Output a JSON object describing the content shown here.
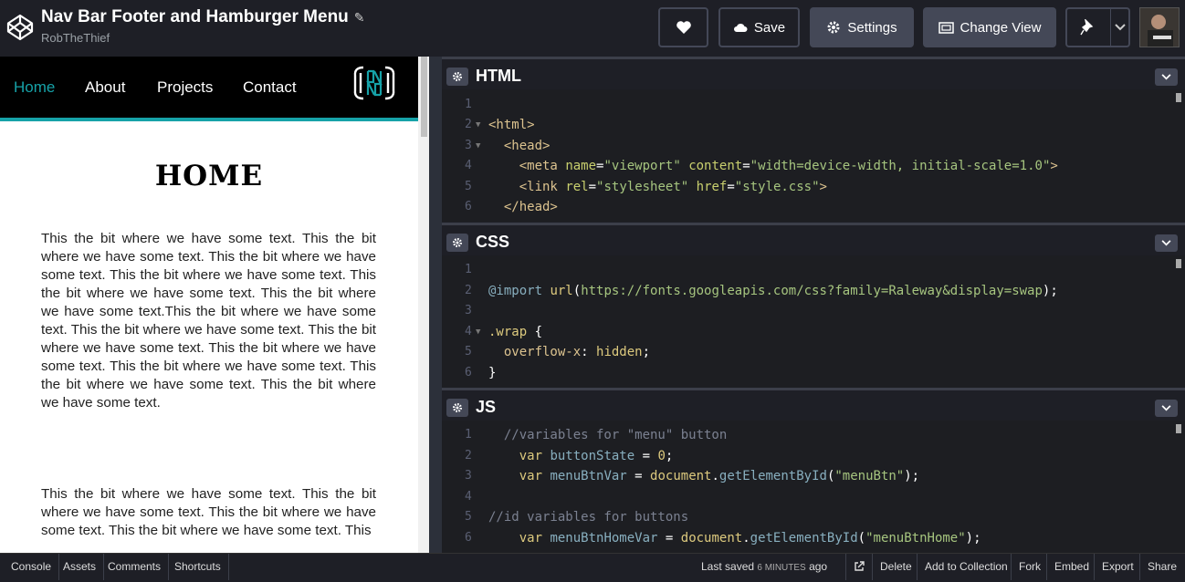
{
  "header": {
    "title": "Nav Bar Footer and Hamburger Menu",
    "author": "RobTheThief",
    "save_label": "Save",
    "settings_label": "Settings",
    "change_view_label": "Change View"
  },
  "preview": {
    "nav": [
      "Home",
      "About",
      "Projects",
      "Contact"
    ],
    "heading": "HOME",
    "paragraph1": "This the bit where we have some text. This the bit where we have some text. This the bit where we have some text. This the bit where we have some text. This the bit where we have some text. This the bit where we have some text.This the bit where we have some text. This the bit where we have some text. This the bit where we have some text. This the bit where we have some text. This the bit where we have some text. This the bit where we have some text. This the bit where we have some text.",
    "paragraph2": "This the bit where we have some text. This the bit where we have some text. This the bit where we have some text. This the bit where we have some text. This"
  },
  "editors": {
    "html_label": "HTML",
    "css_label": "CSS",
    "js_label": "JS"
  },
  "footer": {
    "console": "Console",
    "assets": "Assets",
    "comments": "Comments",
    "shortcuts": "Shortcuts",
    "saved_prefix": "Last saved",
    "saved_time": "6 MINUTES",
    "saved_suffix": "ago",
    "delete": "Delete",
    "add_collection": "Add to Collection",
    "fork": "Fork",
    "embed": "Embed",
    "export": "Export",
    "share": "Share"
  }
}
